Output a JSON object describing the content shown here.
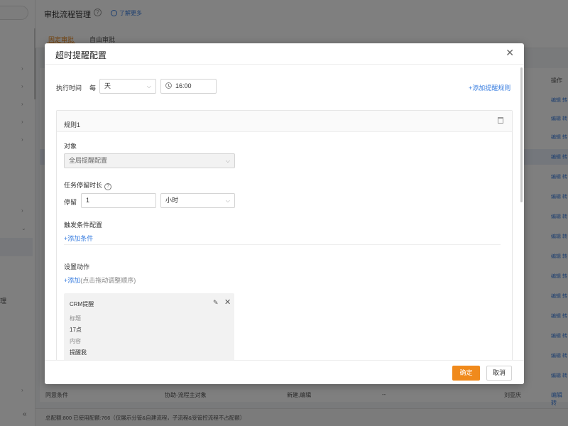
{
  "background": {
    "page_title": "审批流程管理",
    "learn_more": "了解更多",
    "tabs": [
      "固定审批",
      "自由审批"
    ],
    "sidebar_partial_text": "理",
    "table": {
      "op_header": "操作",
      "edit_link": "编辑 转",
      "bottom_row": [
        "同意条件",
        "协助-流程主对象",
        "新建,编辑",
        "--",
        "刘亚庆"
      ]
    },
    "footer_text": "总配额:800 已使用配额:766（仅展示分管&自建流程，子流程&受管控流程不占配额）"
  },
  "modal": {
    "title": "超时提醒配置",
    "exec_time": {
      "label": "执行时间",
      "every": "每",
      "unit_value": "天",
      "time_value": "16:00"
    },
    "add_rule_link": "+添加提醒规则",
    "rule": {
      "title": "规则1",
      "target_label": "对象",
      "target_value": "全局提醒配置",
      "duration_label": "任务停留时长",
      "stay_label": "停留",
      "stay_value": "1",
      "stay_unit": "小时",
      "trigger_label": "触发条件配置",
      "add_condition": "+添加条件",
      "action_label": "设置动作",
      "add_action": "+添加",
      "add_action_hint": "(点击拖动调整顺序)",
      "action_card": {
        "type": "CRM提醒",
        "title_key": "标题",
        "title_value": "17点",
        "content_key": "内容",
        "content_value": "提醒我"
      }
    },
    "buttons": {
      "ok": "确定",
      "cancel": "取消"
    }
  },
  "colors": {
    "accent": "#f08a1c",
    "link": "#3b7fe0"
  }
}
